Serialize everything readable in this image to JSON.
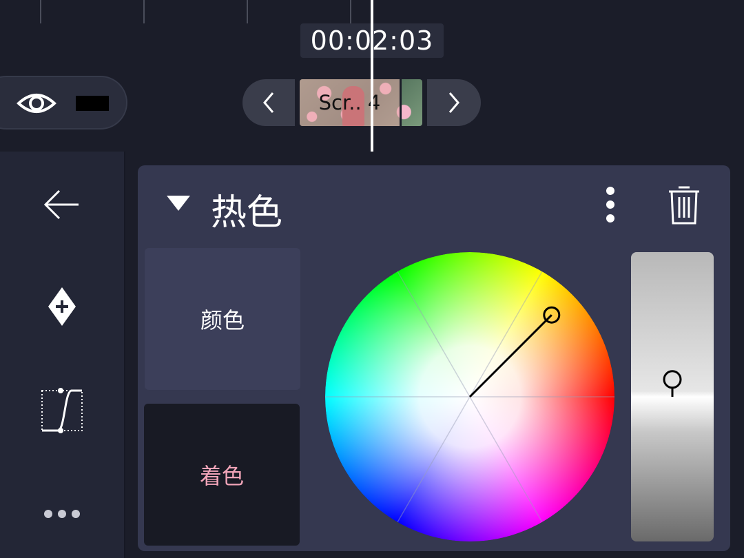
{
  "timeline": {
    "timecode": "00:02:03",
    "clip_label": "Scr.. 4"
  },
  "panel": {
    "title": "热色",
    "tabs": [
      {
        "label": "颜色",
        "selected": false
      },
      {
        "label": "着色",
        "selected": true
      }
    ],
    "hue_angle_degrees": 45,
    "saturation": 0.8,
    "brightness": 0.56
  },
  "colors": {
    "background": "#1b1d29",
    "panel": "#353850",
    "tint_tab_text": "#f2a5b9"
  },
  "icons": [
    "eye-icon",
    "chevron-left-icon",
    "chevron-right-icon",
    "back-arrow-icon",
    "add-keyframe-icon",
    "curve-icon",
    "more-horizontal-icon",
    "collapse-triangle-icon",
    "more-vertical-icon",
    "trash-icon"
  ]
}
